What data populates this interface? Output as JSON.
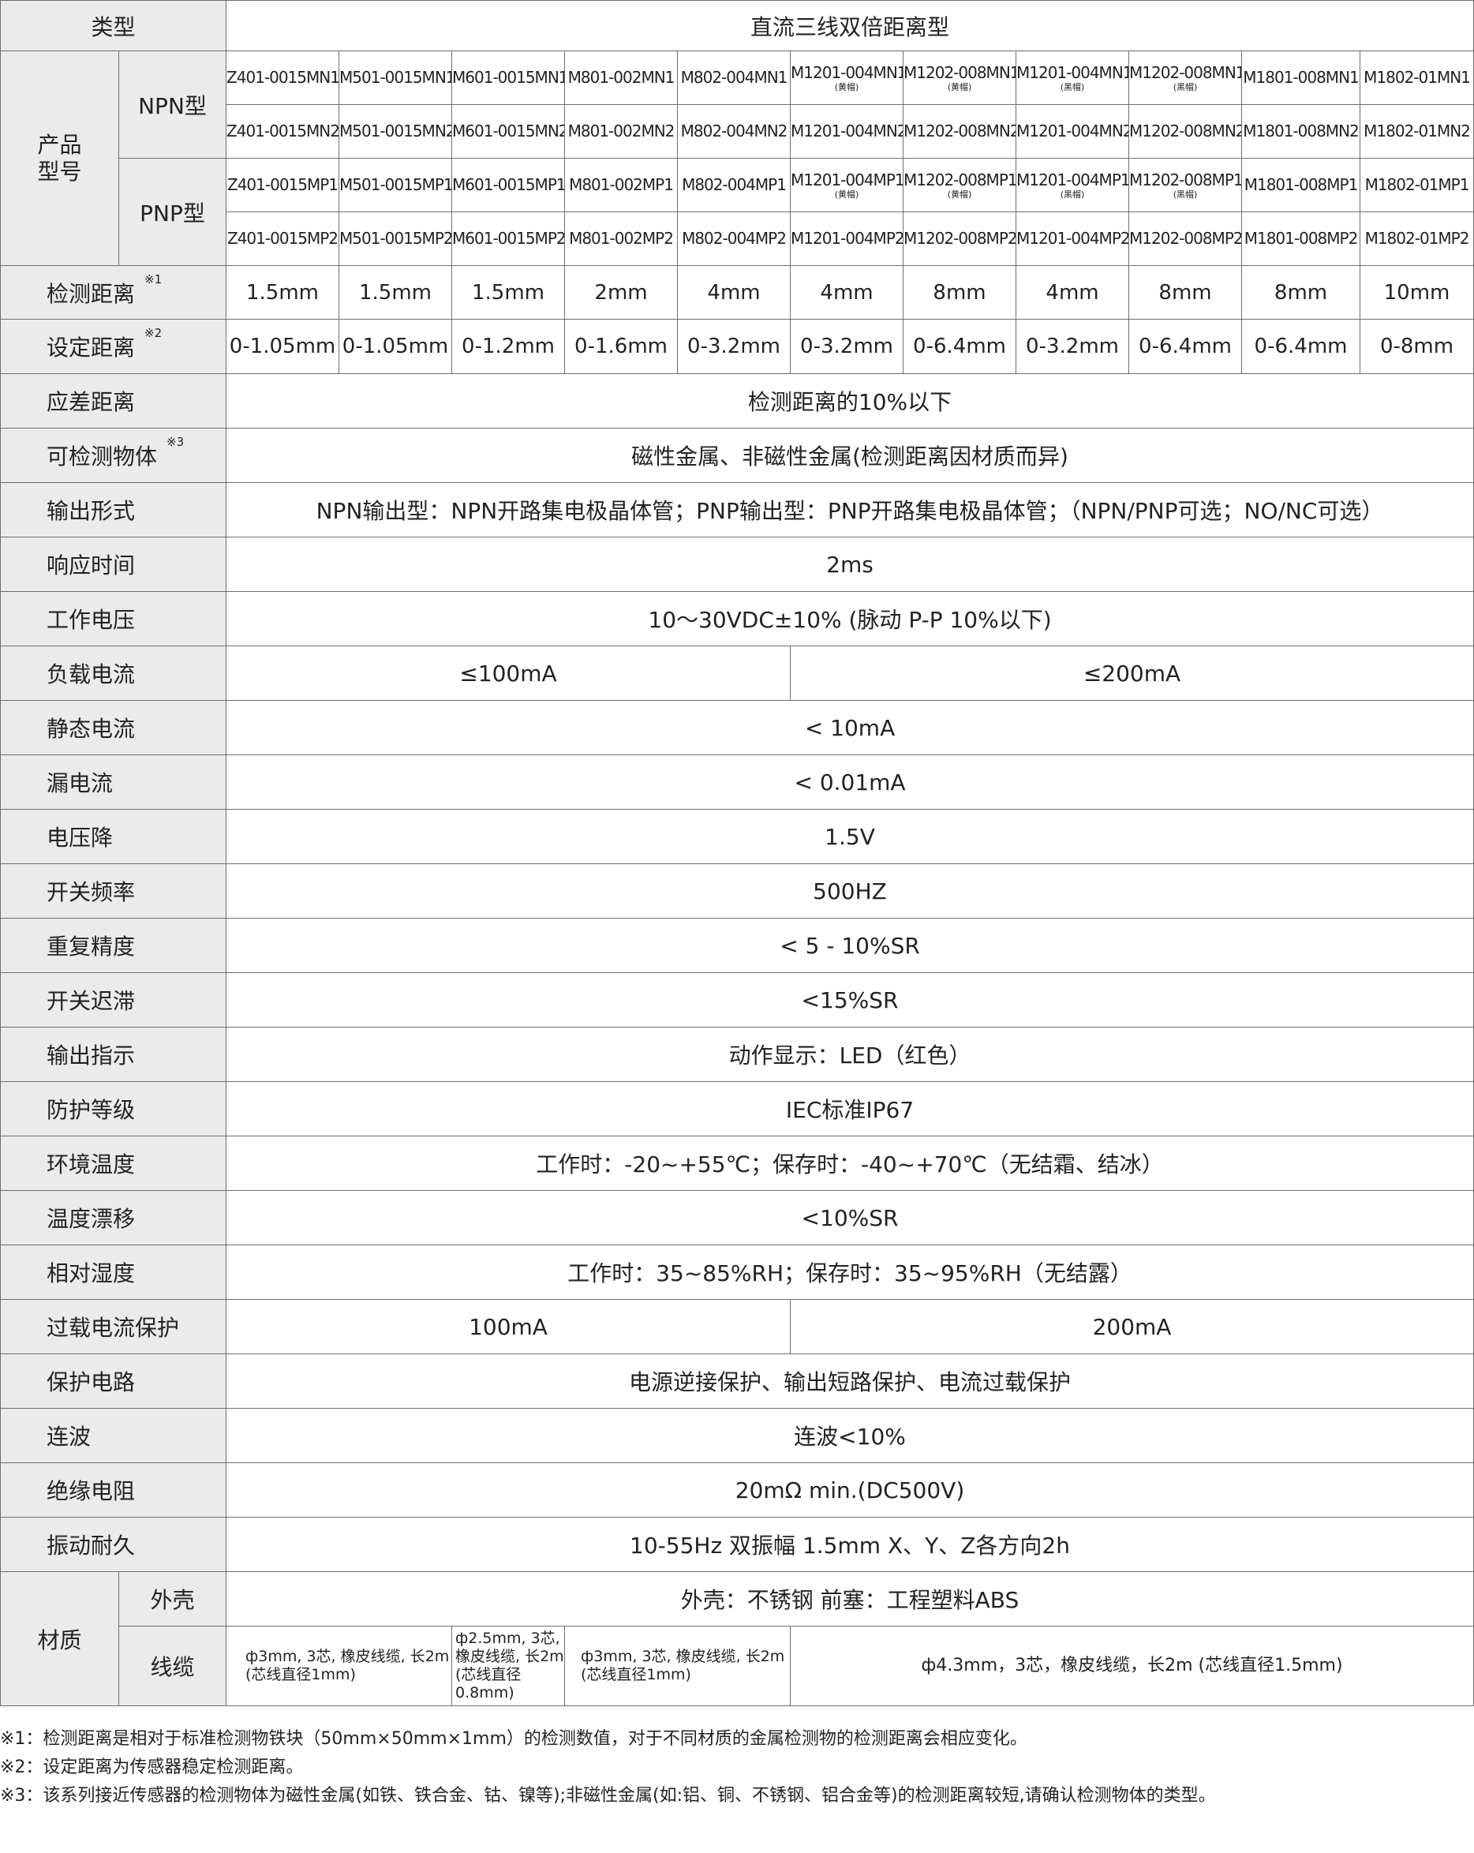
{
  "header": {
    "type_label": "类型",
    "category": "直流三线双倍距离型"
  },
  "product": {
    "label": "产品\n型号",
    "npn_label": "NPN型",
    "pnp_label": "PNP型",
    "npn_row1": [
      {
        "model": "Z401-0015MN1",
        "note": ""
      },
      {
        "model": "M501-0015MN1",
        "note": ""
      },
      {
        "model": "M601-0015MN1",
        "note": ""
      },
      {
        "model": "M801-002MN1",
        "note": ""
      },
      {
        "model": "M802-004MN1",
        "note": ""
      },
      {
        "model": "M1201-004MN1",
        "note": "(黄帽)"
      },
      {
        "model": "M1202-008MN1",
        "note": "(黄帽)"
      },
      {
        "model": "M1201-004MN1",
        "note": "(黑帽)"
      },
      {
        "model": "M1202-008MN1",
        "note": "(黑帽)"
      },
      {
        "model": "M1801-008MN1",
        "note": ""
      },
      {
        "model": "M1802-01MN1",
        "note": ""
      }
    ],
    "npn_row2": [
      {
        "model": "Z401-0015MN2",
        "note": ""
      },
      {
        "model": "M501-0015MN2",
        "note": ""
      },
      {
        "model": "M601-0015MN2",
        "note": ""
      },
      {
        "model": "M801-002MN2",
        "note": ""
      },
      {
        "model": "M802-004MN2",
        "note": ""
      },
      {
        "model": "M1201-004MN2",
        "note": ""
      },
      {
        "model": "M1202-008MN2",
        "note": ""
      },
      {
        "model": "M1201-004MN2",
        "note": ""
      },
      {
        "model": "M1202-008MN2",
        "note": ""
      },
      {
        "model": "M1801-008MN2",
        "note": ""
      },
      {
        "model": "M1802-01MN2",
        "note": ""
      }
    ],
    "pnp_row1": [
      {
        "model": "Z401-0015MP1",
        "note": ""
      },
      {
        "model": "M501-0015MP1",
        "note": ""
      },
      {
        "model": "M601-0015MP1",
        "note": ""
      },
      {
        "model": "M801-002MP1",
        "note": ""
      },
      {
        "model": "M802-004MP1",
        "note": ""
      },
      {
        "model": "M1201-004MP1",
        "note": "(黄帽)"
      },
      {
        "model": "M1202-008MP1",
        "note": "(黄帽)"
      },
      {
        "model": "M1201-004MP1",
        "note": "(黑帽)"
      },
      {
        "model": "M1202-008MP1",
        "note": "(黑帽)"
      },
      {
        "model": "M1801-008MP1",
        "note": ""
      },
      {
        "model": "M1802-01MP1",
        "note": ""
      }
    ],
    "pnp_row2": [
      {
        "model": "Z401-0015MP2",
        "note": ""
      },
      {
        "model": "M501-0015MP2",
        "note": ""
      },
      {
        "model": "M601-0015MP2",
        "note": ""
      },
      {
        "model": "M801-002MP2",
        "note": ""
      },
      {
        "model": "M802-004MP2",
        "note": ""
      },
      {
        "model": "M1201-004MP2",
        "note": ""
      },
      {
        "model": "M1202-008MP2",
        "note": ""
      },
      {
        "model": "M1201-004MP2",
        "note": ""
      },
      {
        "model": "M1202-008MP2",
        "note": ""
      },
      {
        "model": "M1801-008MP2",
        "note": ""
      },
      {
        "model": "M1802-01MP2",
        "note": ""
      }
    ]
  },
  "detect_distance": {
    "label": "检测距离",
    "mark": "※1",
    "values": [
      "1.5mm",
      "1.5mm",
      "1.5mm",
      "2mm",
      "4mm",
      "4mm",
      "8mm",
      "4mm",
      "8mm",
      "8mm",
      "10mm"
    ]
  },
  "set_distance": {
    "label": "设定距离",
    "mark": "※2",
    "values": [
      "0-1.05mm",
      "0-1.05mm",
      "0-1.2mm",
      "0-1.6mm",
      "0-3.2mm",
      "0-3.2mm",
      "0-6.4mm",
      "0-3.2mm",
      "0-6.4mm",
      "0-6.4mm",
      "0-8mm"
    ]
  },
  "specs": {
    "hysteresis": {
      "label": "应差距离",
      "value": "检测距离的10%以下"
    },
    "target": {
      "label": "可检测物体",
      "mark": "※3",
      "value": "磁性金属、非磁性金属(检测距离因材质而异)"
    },
    "output": {
      "label": "输出形式",
      "value": "NPN输出型：NPN开路集电极晶体管；PNP输出型：PNP开路集电极晶体管；（NPN/PNP可选；NO/NC可选）"
    },
    "response": {
      "label": "响应时间",
      "value": "2ms"
    },
    "voltage": {
      "label": "工作电压",
      "value": "10～30VDC±10% (脉动 P-P 10%以下)"
    },
    "load_current": {
      "label": "负载电流",
      "value_a": "≤100mA",
      "value_b": "≤200mA"
    },
    "static_current": {
      "label": "静态电流",
      "value": "< 10mA"
    },
    "leakage": {
      "label": "漏电流",
      "value": "< 0.01mA"
    },
    "voltage_drop": {
      "label": "电压降",
      "value": "1.5V"
    },
    "frequency": {
      "label": "开关频率",
      "value": "500HZ"
    },
    "repeat": {
      "label": "重复精度",
      "value": "< 5 - 10%SR"
    },
    "hysteresis_switch": {
      "label": "开关迟滞",
      "value": "<15%SR"
    },
    "indicator": {
      "label": "输出指示",
      "value": "动作显示：LED（红色）"
    },
    "protection_grade": {
      "label": "防护等级",
      "value": "IEC标准IP67"
    },
    "ambient_temp": {
      "label": "环境温度",
      "value": "工作时：-20~+55℃；保存时：-40~+70℃（无结霜、结冰）"
    },
    "temp_drift": {
      "label": "温度漂移",
      "value": "<10%SR"
    },
    "humidity": {
      "label": "相对湿度",
      "value": "工作时：35~85%RH；保存时：35~95%RH（无结露）"
    },
    "overload": {
      "label": "过载电流保护",
      "value_a": "100mA",
      "value_b": "200mA"
    },
    "circuit": {
      "label": "保护电路",
      "value": "电源逆接保护、输出短路保护、电流过载保护"
    },
    "ripple": {
      "label": "连波",
      "value": "连波<10%"
    },
    "insulation": {
      "label": "绝缘电阻",
      "value": "20mΩ min.(DC500V)"
    },
    "vibration": {
      "label": "振动耐久",
      "value": "10-55Hz 双振幅 1.5mm  X、Y、Z各方向2h"
    }
  },
  "material": {
    "label": "材质",
    "housing_label": "外壳",
    "housing_value": "外壳：不锈钢  前塞：工程塑料ABS",
    "cable_label": "线缆",
    "cable_a": "ф3mm, 3芯, 橡皮线缆, 长2m\n(芯线直径1mm)",
    "cable_b": "ф2.5mm, 3芯,\n橡皮线缆, 长2m\n(芯线直径0.8mm)",
    "cable_c": "ф3mm, 3芯, 橡皮线缆, 长2m\n(芯线直径1mm)",
    "cable_d": "ф4.3mm，3芯，橡皮线缆，长2m (芯线直径1.5mm)"
  },
  "notes": [
    "※1：检测距离是相对于标准检测物铁块（50mm×50mm×1mm）的检测数值，对于不同材质的金属检测物的检测距离会相应变化。",
    "※2：设定距离为传感器稳定检测距离。",
    "※3：该系列接近传感器的检测物体为磁性金属(如铁、铁合金、钴、镍等);非磁性金属(如:铝、铜、不锈钢、铝合金等)的检测距离较短,请确认检测物体的类型。"
  ]
}
